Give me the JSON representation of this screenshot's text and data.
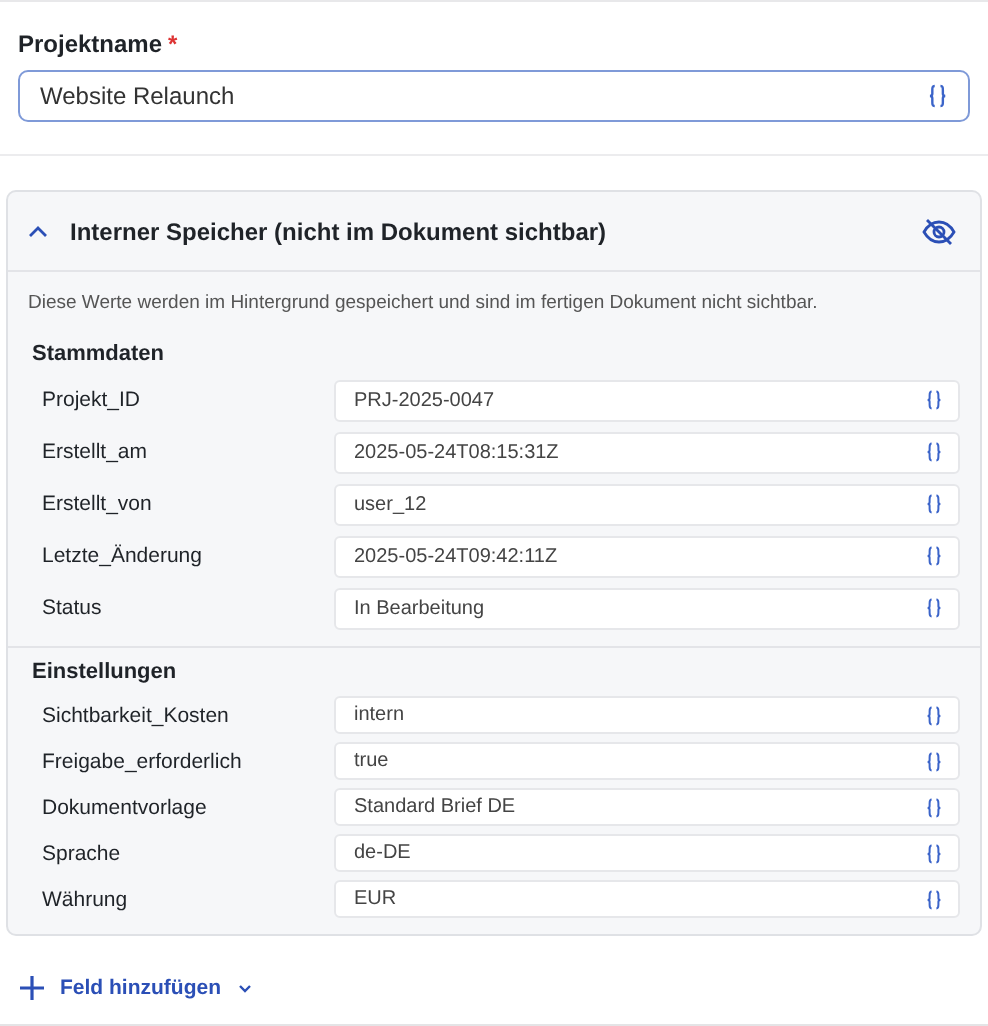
{
  "project_name": {
    "label": "Projektname",
    "required_mark": "*",
    "value": "Website Relaunch"
  },
  "internal_storage": {
    "title": "Interner Speicher (nicht im Dokument sichtbar)",
    "expanded": true,
    "description": "Diese Werte werden im Hintergrund gespeichert und sind im fertigen Dokument nicht sichtbar.",
    "groups": [
      {
        "title": "Stammdaten",
        "kind": "regular",
        "fields": [
          {
            "label": "Projekt_ID",
            "value": "PRJ-2025-0047"
          },
          {
            "label": "Erstellt_am",
            "value": "2025-05-24T08:15:31Z"
          },
          {
            "label": "Erstellt_von",
            "value": "user_12"
          },
          {
            "label": "Letzte_Änderung",
            "value": "2025-05-24T09:42:11Z"
          },
          {
            "label": "Status",
            "value": "In Bearbeitung"
          }
        ]
      },
      {
        "title": "Einstellungen",
        "kind": "compact",
        "fields": [
          {
            "label": "Sichtbarkeit_Kosten",
            "value": "intern"
          },
          {
            "label": "Freigabe_erforderlich",
            "value": "true"
          },
          {
            "label": "Dokumentvorlage",
            "value": "Standard Brief DE"
          },
          {
            "label": "Sprache",
            "value": "de-DE"
          },
          {
            "label": "Währung",
            "value": "EUR"
          }
        ]
      }
    ]
  },
  "add_field": {
    "label": "Feld hinzufügen"
  }
}
